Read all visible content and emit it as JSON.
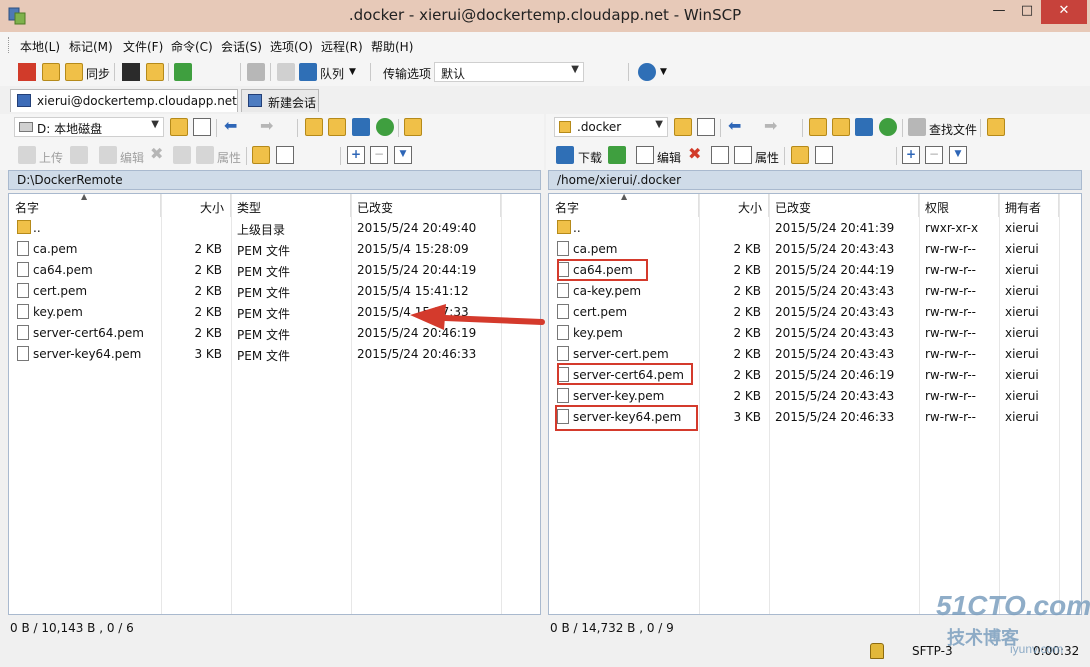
{
  "window": {
    "title": ".docker - xierui@dockertemp.cloudapp.net - WinSCP",
    "min": "—",
    "max": "□",
    "close": "✕"
  },
  "menu": [
    "本地(L)",
    "标记(M)",
    "文件(F)",
    "命令(C)",
    "会话(S)",
    "选项(O)",
    "远程(R)",
    "帮助(H)"
  ],
  "toolbar1": {
    "sync": "同步",
    "queue": "队列",
    "transfer_label": "传输选项",
    "transfer_value": "默认"
  },
  "tabs": [
    {
      "label": "xierui@dockertemp.cloudapp.net"
    },
    {
      "label": "新建会话"
    }
  ],
  "left": {
    "drive": "D: 本地磁盘",
    "actions": {
      "upload": "上传",
      "edit": "编辑",
      "props": "属性"
    },
    "path": "D:\\DockerRemote",
    "headers": [
      "名字",
      "大小",
      "类型",
      "已改变"
    ],
    "rows": [
      {
        "name": "..",
        "size": "",
        "type": "上级目录",
        "date": "2015/5/24  20:49:40",
        "icon": "up"
      },
      {
        "name": "ca.pem",
        "size": "2 KB",
        "type": "PEM 文件",
        "date": "2015/5/4  15:28:09",
        "icon": "file"
      },
      {
        "name": "ca64.pem",
        "size": "2 KB",
        "type": "PEM 文件",
        "date": "2015/5/24  20:44:19",
        "icon": "file"
      },
      {
        "name": "cert.pem",
        "size": "2 KB",
        "type": "PEM 文件",
        "date": "2015/5/4  15:41:12",
        "icon": "file"
      },
      {
        "name": "key.pem",
        "size": "2 KB",
        "type": "PEM 文件",
        "date": "2015/5/4  15:37:33",
        "icon": "file"
      },
      {
        "name": "server-cert64.pem",
        "size": "2 KB",
        "type": "PEM 文件",
        "date": "2015/5/24  20:46:19",
        "icon": "file"
      },
      {
        "name": "server-key64.pem",
        "size": "3 KB",
        "type": "PEM 文件",
        "date": "2015/5/24  20:46:33",
        "icon": "file"
      }
    ],
    "status": "0 B / 10,143 B ,  0 / 6"
  },
  "right": {
    "dir": ".docker",
    "find": "查找文件",
    "actions": {
      "download": "下载",
      "edit": "编辑",
      "props": "属性"
    },
    "path": "/home/xierui/.docker",
    "headers": [
      "名字",
      "大小",
      "已改变",
      "权限",
      "拥有者"
    ],
    "rows": [
      {
        "name": "..",
        "size": "",
        "date": "2015/5/24 20:41:39",
        "perm": "rwxr-xr-x",
        "owner": "xierui",
        "icon": "up"
      },
      {
        "name": "ca.pem",
        "size": "2 KB",
        "date": "2015/5/24 20:43:43",
        "perm": "rw-rw-r--",
        "owner": "xierui",
        "icon": "file"
      },
      {
        "name": "ca64.pem",
        "size": "2 KB",
        "date": "2015/5/24 20:44:19",
        "perm": "rw-rw-r--",
        "owner": "xierui",
        "icon": "file"
      },
      {
        "name": "ca-key.pem",
        "size": "2 KB",
        "date": "2015/5/24 20:43:43",
        "perm": "rw-rw-r--",
        "owner": "xierui",
        "icon": "file"
      },
      {
        "name": "cert.pem",
        "size": "2 KB",
        "date": "2015/5/24 20:43:43",
        "perm": "rw-rw-r--",
        "owner": "xierui",
        "icon": "file"
      },
      {
        "name": "key.pem",
        "size": "2 KB",
        "date": "2015/5/24 20:43:43",
        "perm": "rw-rw-r--",
        "owner": "xierui",
        "icon": "file"
      },
      {
        "name": "server-cert.pem",
        "size": "2 KB",
        "date": "2015/5/24 20:43:43",
        "perm": "rw-rw-r--",
        "owner": "xierui",
        "icon": "file"
      },
      {
        "name": "server-cert64.pem",
        "size": "2 KB",
        "date": "2015/5/24 20:46:19",
        "perm": "rw-rw-r--",
        "owner": "xierui",
        "icon": "file"
      },
      {
        "name": "server-key.pem",
        "size": "2 KB",
        "date": "2015/5/24 20:43:43",
        "perm": "rw-rw-r--",
        "owner": "xierui",
        "icon": "file"
      },
      {
        "name": "server-key64.pem",
        "size": "3 KB",
        "date": "2015/5/24 20:46:33",
        "perm": "rw-rw-r--",
        "owner": "xierui",
        "icon": "file"
      }
    ],
    "status": "0 B / 14,732 B ,  0 / 9"
  },
  "bottom": {
    "protocol": "SFTP-3",
    "time": "0:00:32"
  },
  "watermark": {
    "line1": "51CTO.com",
    "line2": "技术博客",
    "line3": "iyunv.com"
  },
  "colors": {
    "highlight": "#d43a2c",
    "path_bar": "#cfdbe8",
    "title_bar": "#e7c9b8"
  }
}
